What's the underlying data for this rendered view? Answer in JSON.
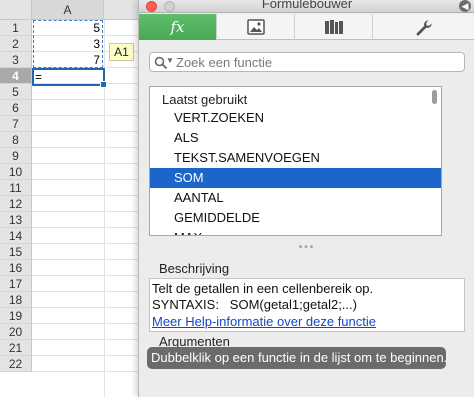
{
  "sheet": {
    "column_header": "A",
    "rows": [
      "1",
      "2",
      "3",
      "4",
      "5",
      "6",
      "7",
      "8",
      "9",
      "10",
      "11",
      "12",
      "13",
      "14",
      "15",
      "16",
      "17",
      "18",
      "19",
      "20",
      "21",
      "22"
    ],
    "active_row": "4",
    "cells": {
      "a1": "5",
      "a2": "3",
      "a3": "7",
      "a4": "="
    },
    "tooltip": "A1"
  },
  "panel": {
    "title": "Formulebouwer",
    "tabs": [
      {
        "name": "fx",
        "label": "fx",
        "icon": "function-icon"
      },
      {
        "name": "images",
        "icon": "image-icon"
      },
      {
        "name": "library",
        "icon": "books-icon"
      },
      {
        "name": "tools",
        "icon": "wrench-icon"
      }
    ],
    "search": {
      "placeholder": "Zoek een functie"
    },
    "list": {
      "header": "Laatst gebruikt",
      "items": [
        "VERT.ZOEKEN",
        "ALS",
        "TEKST.SAMENVOEGEN",
        "SOM",
        "AANTAL",
        "GEMIDDELDE",
        "MAX"
      ],
      "selected": "SOM"
    },
    "splitter": "•••",
    "description": {
      "label": "Beschrijving",
      "text": "Telt de getallen in een cellenbereik op.",
      "syntax_label": "SYNTAXIS:",
      "syntax": "SOM(getal1;getal2;...)",
      "link": "Meer Help-informatie over deze functie"
    },
    "arguments": {
      "label": "Argumenten",
      "hint": "Dubbelklik op een functie in de lijst om te beginnen."
    }
  },
  "colors": {
    "accent_green": "#4fb25c",
    "selection_blue": "#1b66c8",
    "close_red": "#ff5f57"
  }
}
